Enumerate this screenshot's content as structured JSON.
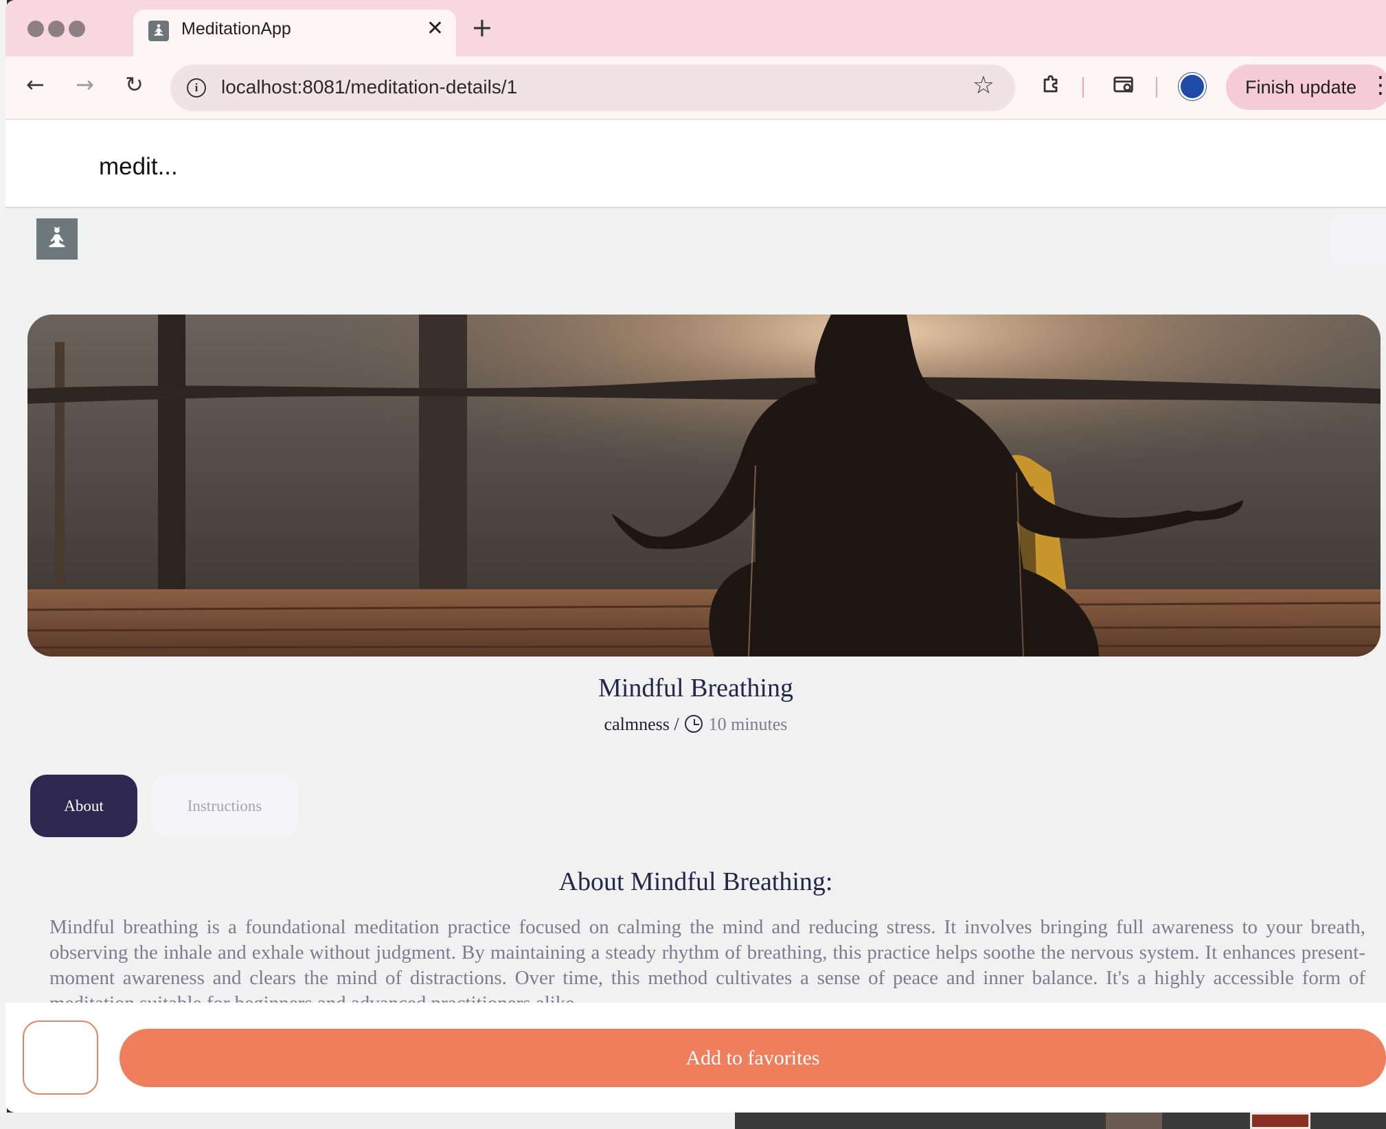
{
  "browser": {
    "tab_title": "MeditationApp",
    "tab_close": "✕",
    "new_tab": "+",
    "url": "localhost:8081/meditation-details/1",
    "finish_update_label": "Finish update",
    "back": "←",
    "forward": "→",
    "reload": "↻",
    "star": "☆",
    "kebab": "⋮"
  },
  "app": {
    "header_title": "medit..."
  },
  "meditation": {
    "title": "Mindful Breathing",
    "category": "calmness",
    "separator": " / ",
    "duration": "10 minutes"
  },
  "tabs": {
    "about": "About",
    "instructions": "Instructions"
  },
  "about": {
    "heading": "About Mindful Breathing:",
    "body": "Mindful breathing is a foundational meditation practice focused on calming the mind and reducing stress. It involves bringing full awareness to your breath, observing the inhale and exhale without judgment. By maintaining a steady rhythm of breathing, this practice helps soothe the nervous system. It enhances present-moment awareness and clears the mind of distractions. Over time, this method cultivates a sense of peace and inner balance. It's a highly accessible form of meditation suitable for beginners and advanced practitioners alike."
  },
  "footer": {
    "add_to_favorites": "Add to favorites"
  },
  "colors": {
    "tab_strip": "#f8d8df",
    "primary_dark": "#2e2750",
    "accent_orange": "#ef7f5c",
    "title_color": "#27244a"
  },
  "icons": {
    "favicon": "meditation-person-icon",
    "logo": "meditation-person-icon",
    "info": "info-icon",
    "extensions": "puzzle-icon",
    "search_tab": "tab-search-icon",
    "profile": "profile-avatar-icon",
    "clock": "clock-icon"
  }
}
